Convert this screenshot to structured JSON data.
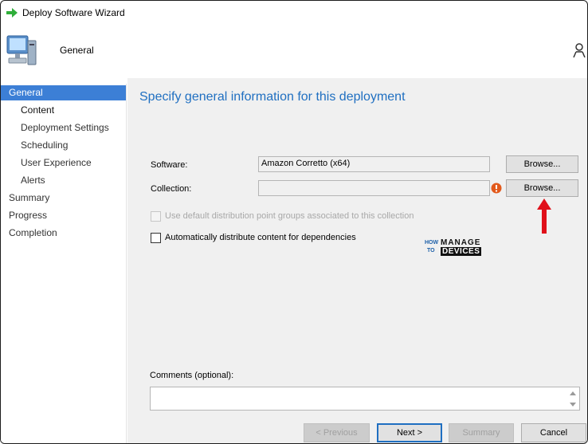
{
  "window": {
    "title": "Deploy Software Wizard"
  },
  "header": {
    "title": "General"
  },
  "sidebar": {
    "items": [
      {
        "label": "General",
        "level": "top",
        "active": true
      },
      {
        "label": "Content",
        "level": "sub",
        "active": false
      },
      {
        "label": "Deployment Settings",
        "level": "sub",
        "active": false
      },
      {
        "label": "Scheduling",
        "level": "sub",
        "active": false
      },
      {
        "label": "User Experience",
        "level": "sub",
        "active": false
      },
      {
        "label": "Alerts",
        "level": "sub",
        "active": false
      },
      {
        "label": "Summary",
        "level": "top",
        "active": false
      },
      {
        "label": "Progress",
        "level": "top",
        "active": false
      },
      {
        "label": "Completion",
        "level": "top",
        "active": false
      }
    ]
  },
  "main": {
    "heading": "Specify general information for this deployment",
    "software": {
      "label": "Software:",
      "value": "Amazon Corretto (x64)",
      "browse_label": "Browse..."
    },
    "collection": {
      "label": "Collection:",
      "value": "",
      "browse_label": "Browse...",
      "error_icon": "exclamation-icon"
    },
    "options": {
      "use_default_dp_groups": {
        "label": "Use default distribution point groups associated to this collection",
        "checked": false,
        "enabled": false
      },
      "auto_distribute": {
        "label": "Automatically distribute content for dependencies",
        "checked": false,
        "enabled": true
      }
    },
    "comments": {
      "label": "Comments (optional):",
      "value": ""
    }
  },
  "watermark": {
    "line1": "HOW",
    "line2": "TO",
    "word1": "MANAGE",
    "word2": "DEVICES"
  },
  "footer": {
    "previous_label": "< Previous",
    "next_label": "Next >",
    "summary_label": "Summary",
    "cancel_label": "Cancel"
  },
  "colors": {
    "accent": "#3c7fd6",
    "heading": "#1f6fc1",
    "annotation_arrow": "#e0101a",
    "panel_bg": "#f0f0f0"
  }
}
